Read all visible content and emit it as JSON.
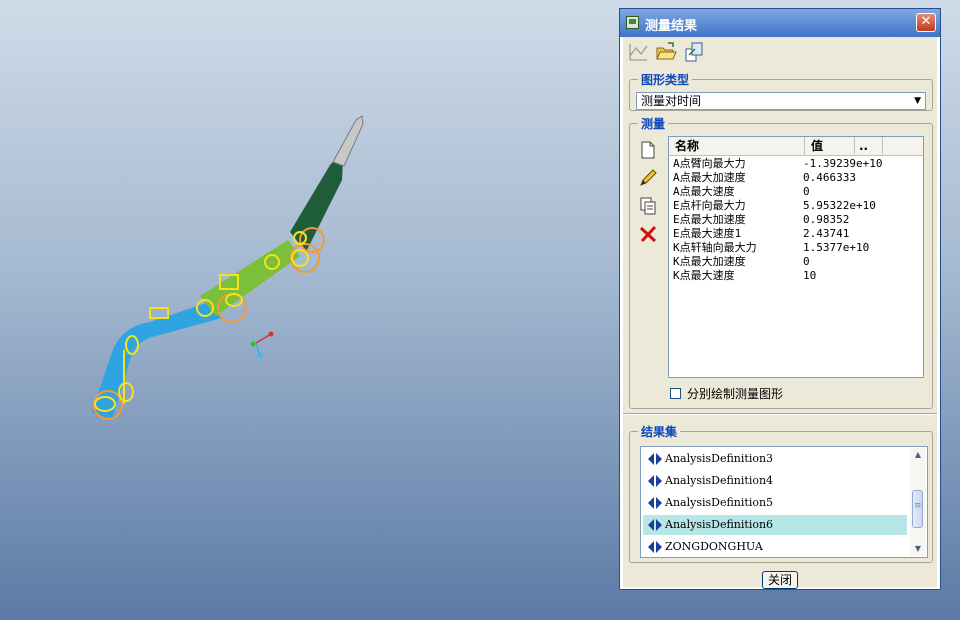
{
  "dialog": {
    "title": "测量结果",
    "close_label": "关闭"
  },
  "graph_type": {
    "legend": "图形类型",
    "selected": "测量对时间"
  },
  "measures": {
    "legend": "测量",
    "columns": [
      "名称",
      "值",
      ".."
    ],
    "rows": [
      {
        "name": "A点臂向最大力",
        "value": "-1.39239e+10"
      },
      {
        "name": "A点最大加速度",
        "value": "0.466333"
      },
      {
        "name": "A点最大速度",
        "value": "0"
      },
      {
        "name": "E点杆向最大力",
        "value": "5.95322e+10"
      },
      {
        "name": "E点最大加速度",
        "value": "0.98352"
      },
      {
        "name": "E点最大速度1",
        "value": "2.43741"
      },
      {
        "name": "K点轩轴向最大力",
        "value": "1.5377e+10"
      },
      {
        "name": "K点最大加速度",
        "value": "0"
      },
      {
        "name": "K点最大速度",
        "value": "10"
      }
    ],
    "split_checkbox_label": "分别绘制测量图形",
    "split_checked": false
  },
  "result_set": {
    "legend": "结果集",
    "items": [
      {
        "label": "AnalysisDefinition3",
        "selected": false
      },
      {
        "label": "AnalysisDefinition4",
        "selected": false
      },
      {
        "label": "AnalysisDefinition5",
        "selected": false
      },
      {
        "label": "AnalysisDefinition6",
        "selected": true
      },
      {
        "label": "ZONGDONGHUA",
        "selected": false
      }
    ]
  },
  "icons": {
    "toolbar": [
      "graph-icon",
      "open-folder-icon",
      "export-icon"
    ],
    "side": [
      "new-document-icon",
      "edit-pencil-icon",
      "copy-icon",
      "delete-x-icon"
    ]
  },
  "colors": {
    "selection": "#b7e6e6",
    "legend_text": "#0f48b8",
    "title_bar": "#3f74c8"
  }
}
